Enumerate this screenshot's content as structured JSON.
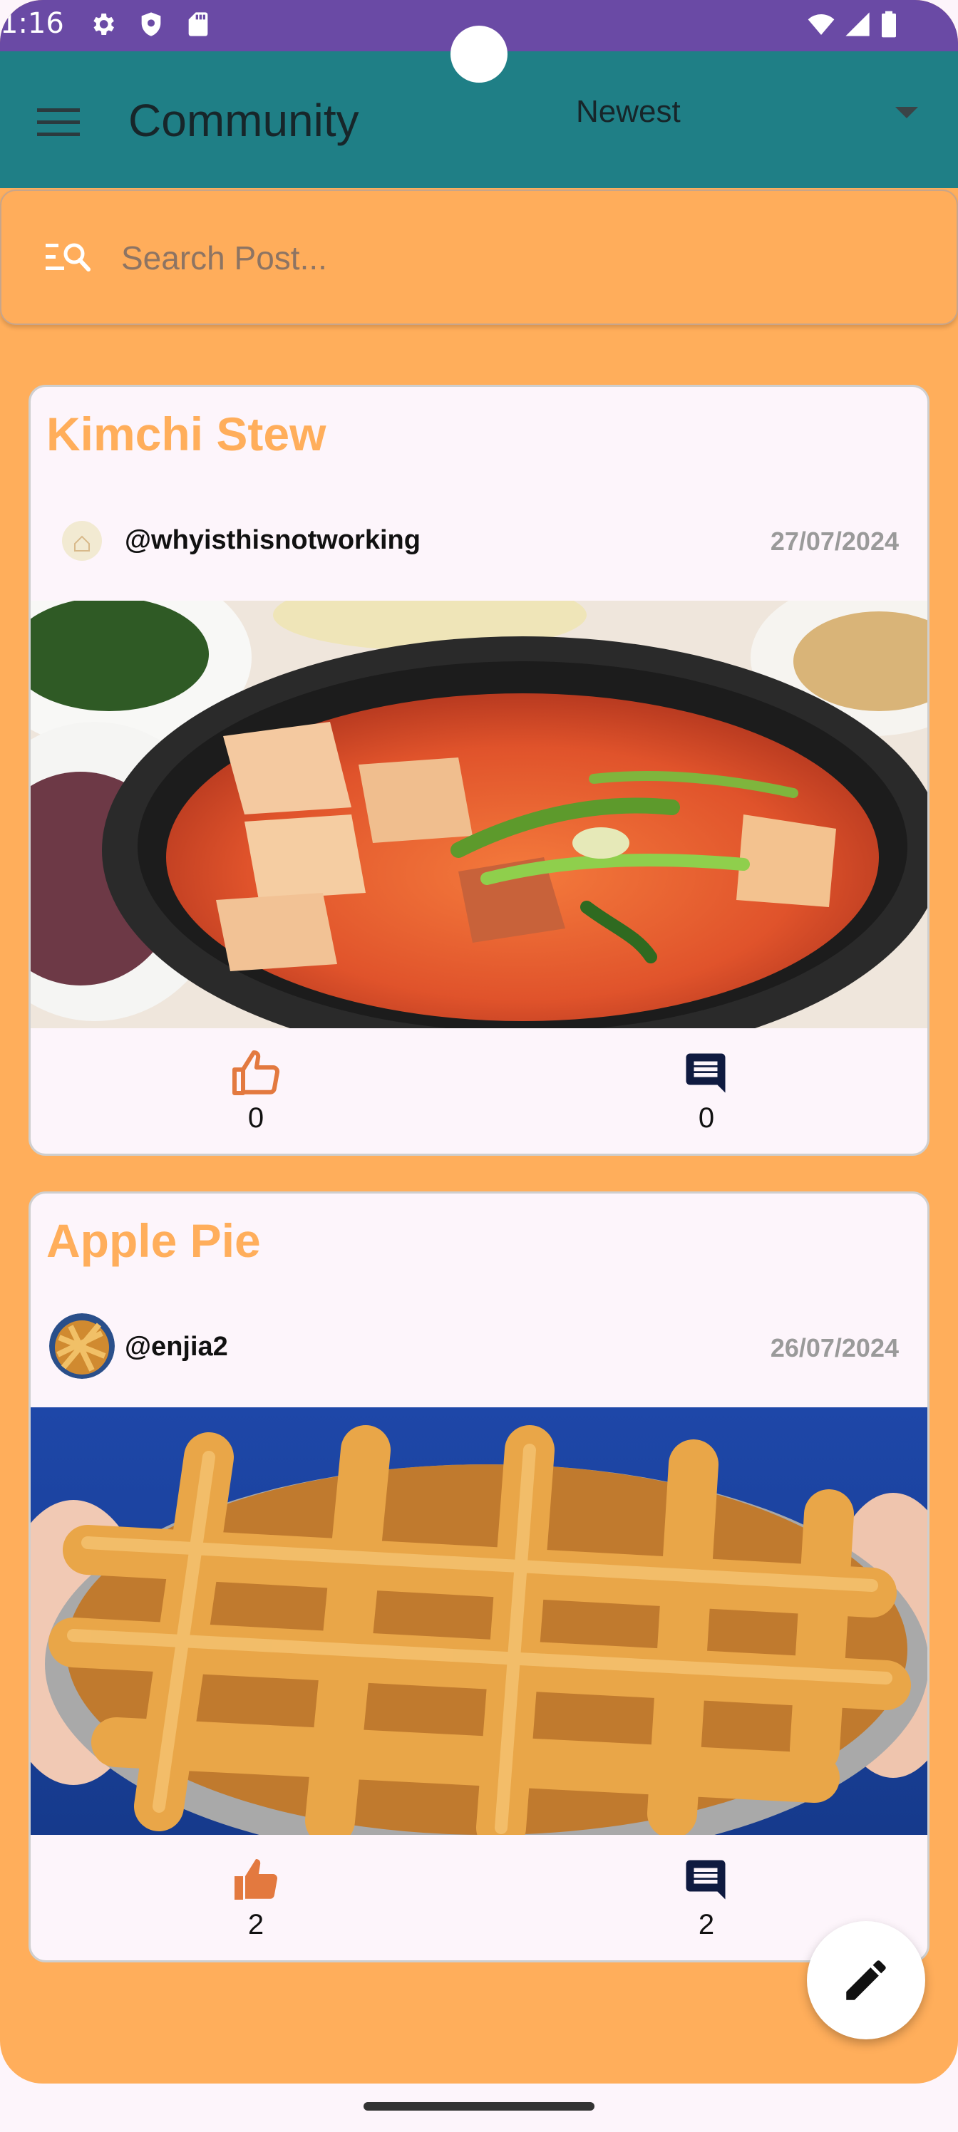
{
  "status_bar": {
    "time": "1:16",
    "icons": [
      "gear-icon",
      "shield-icon",
      "sd-card-icon",
      "wifi-icon",
      "signal-icon",
      "battery-icon"
    ]
  },
  "app_bar": {
    "menu_icon": "menu-icon",
    "title": "Community",
    "sort": {
      "selected": "Newest",
      "icon": "dropdown-caret-icon"
    }
  },
  "search": {
    "icon": "search-list-icon",
    "placeholder": "Search Post...",
    "value": ""
  },
  "posts": [
    {
      "title": "Kimchi Stew",
      "username": "@whyisthisnotworking",
      "date": "27/07/2024",
      "image": "kimchi stew in black clay pot with side dishes",
      "liked": false,
      "likes": "0",
      "comments": "0"
    },
    {
      "title": "Apple Pie",
      "username": "@enjia2",
      "date": "26/07/2024",
      "image": "lattice-top apple pie held in hands",
      "liked": true,
      "likes": "2",
      "comments": "2"
    }
  ],
  "fab": {
    "icon": "pencil-icon"
  },
  "colors": {
    "status_bar": "#6a4aa5",
    "app_bar": "#1f7f86",
    "background": "#ffae5b",
    "card": "#fdf5fb",
    "title_accent": "#ffae5b",
    "like": "#e3793f",
    "comment": "#0f1a40"
  }
}
